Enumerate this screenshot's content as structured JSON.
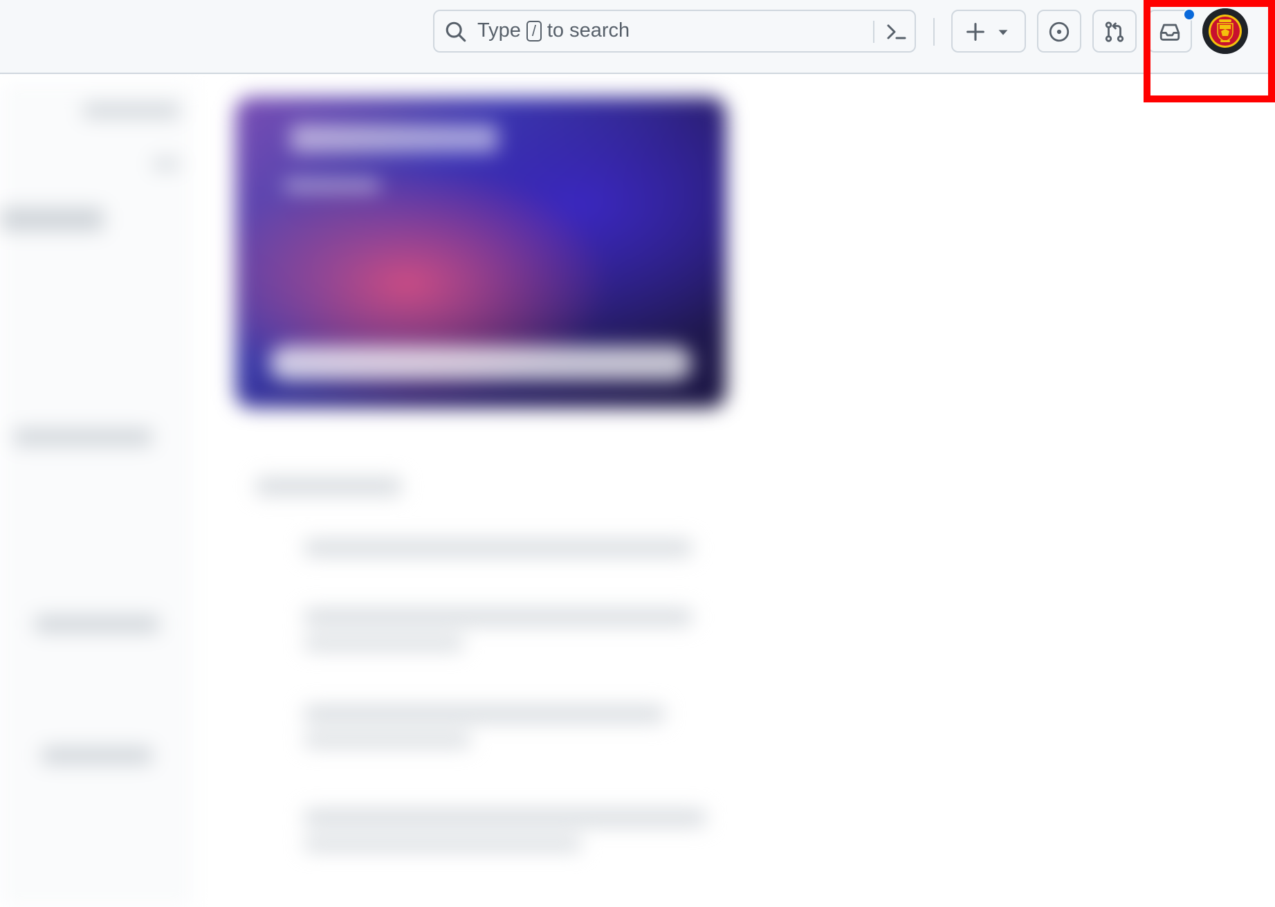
{
  "header": {
    "search": {
      "prefix": "Type",
      "shortcut_key": "/",
      "suffix": "to search"
    },
    "notification_indicator": {
      "color": "#0969da",
      "unread": true
    }
  },
  "colors": {
    "header_bg": "#f6f8fa",
    "border": "#d0d7de",
    "icon": "#57606a",
    "accent": "#0969da",
    "highlight": "#ff0000"
  },
  "icons": {
    "search": "search-icon",
    "command_palette": "command-palette-icon",
    "create": "plus-icon",
    "create_menu": "triangle-down-icon",
    "issues": "issue-opened-icon",
    "pull_requests": "git-pull-request-icon",
    "inbox": "inbox-icon",
    "avatar": "user-avatar-crest"
  }
}
